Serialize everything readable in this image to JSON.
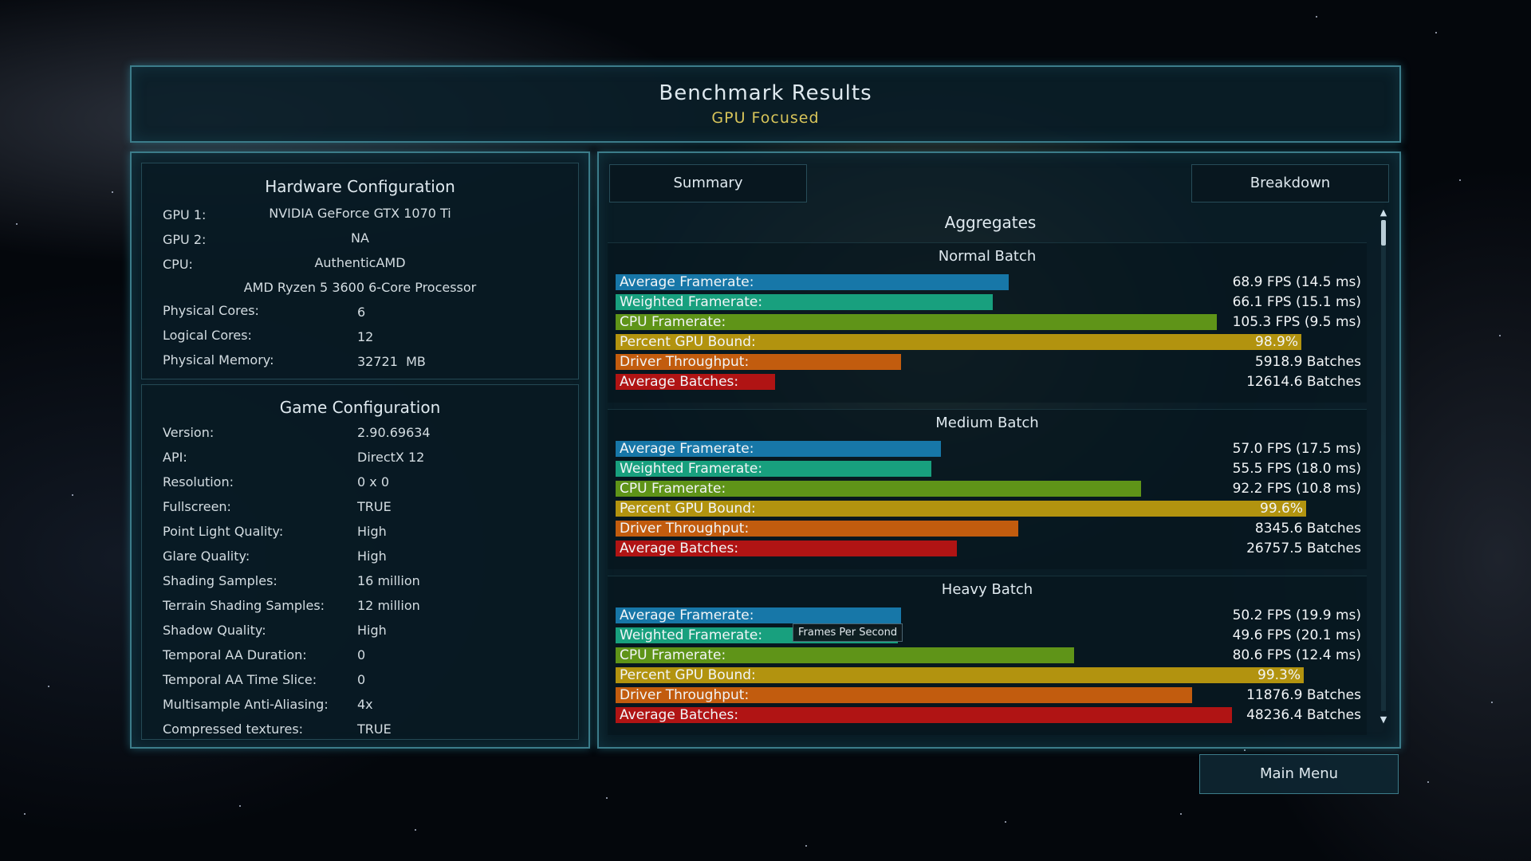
{
  "header": {
    "title": "Benchmark Results",
    "subtitle": "GPU Focused"
  },
  "hardware": {
    "title": "Hardware Configuration",
    "gpu1_label": "GPU 1:",
    "gpu1_value": "NVIDIA GeForce GTX 1070 Ti",
    "gpu2_label": "GPU 2:",
    "gpu2_value": "NA",
    "cpu_label": "CPU:",
    "cpu_value": "AuthenticAMD",
    "cpu_model": "AMD Ryzen 5 3600 6-Core Processor",
    "physical_cores_label": "Physical Cores:",
    "physical_cores_value": "6",
    "logical_cores_label": "Logical Cores:",
    "logical_cores_value": "12",
    "memory_label": "Physical Memory:",
    "memory_value": "32721  MB"
  },
  "game": {
    "title": "Game Configuration",
    "settings": [
      {
        "label": "Version:",
        "value": "2.90.69634"
      },
      {
        "label": "API:",
        "value": "DirectX 12"
      },
      {
        "label": "Resolution:",
        "value": "0 x 0"
      },
      {
        "label": "Fullscreen:",
        "value": "TRUE"
      },
      {
        "label": "Point Light Quality:",
        "value": "High"
      },
      {
        "label": "Glare Quality:",
        "value": "High"
      },
      {
        "label": "Shading Samples:",
        "value": "16 million"
      },
      {
        "label": "Terrain Shading Samples:",
        "value": "12 million"
      },
      {
        "label": "Shadow Quality:",
        "value": "High"
      },
      {
        "label": "Temporal AA Duration:",
        "value": "0"
      },
      {
        "label": "Temporal AA Time Slice:",
        "value": "0"
      },
      {
        "label": "Multisample Anti-Aliasing:",
        "value": "4x"
      },
      {
        "label": "Compressed textures:",
        "value": "TRUE"
      }
    ]
  },
  "tabs": {
    "summary": "Summary",
    "breakdown": "Breakdown"
  },
  "aggregates_title": "Aggregates",
  "colors": {
    "average_framerate": "#1777a8",
    "weighted_framerate": "#18a07e",
    "cpu_framerate": "#5f9418",
    "percent_gpu_bound": "#b2930f",
    "driver_throughput": "#c25c0e",
    "average_batches": "#b01414"
  },
  "batches": [
    {
      "title": "Normal Batch",
      "metrics": [
        {
          "key": "average_framerate",
          "label": "Average Framerate:",
          "value": "68.9 FPS (14.5 ms)",
          "fill": 0.527
        },
        {
          "key": "weighted_framerate",
          "label": "Weighted Framerate:",
          "value": "66.1 FPS (15.1 ms)",
          "fill": 0.506
        },
        {
          "key": "cpu_framerate",
          "label": "CPU Framerate:",
          "value": "105.3 FPS (9.5 ms)",
          "fill": 0.806
        },
        {
          "key": "percent_gpu_bound",
          "label": "Percent GPU Bound:",
          "value": "98.9%",
          "fill": 0.989,
          "inside": true
        },
        {
          "key": "driver_throughput",
          "label": "Driver Throughput:",
          "value": "5918.9 Batches",
          "fill": 0.383
        },
        {
          "key": "average_batches",
          "label": "Average Batches:",
          "value": "12614.6 Batches",
          "fill": 0.214
        }
      ]
    },
    {
      "title": "Medium Batch",
      "metrics": [
        {
          "key": "average_framerate",
          "label": "Average Framerate:",
          "value": "57.0 FPS (17.5 ms)",
          "fill": 0.436
        },
        {
          "key": "weighted_framerate",
          "label": "Weighted Framerate:",
          "value": "55.5 FPS (18.0 ms)",
          "fill": 0.424
        },
        {
          "key": "cpu_framerate",
          "label": "CPU Framerate:",
          "value": "92.2 FPS (10.8 ms)",
          "fill": 0.705
        },
        {
          "key": "percent_gpu_bound",
          "label": "Percent GPU Bound:",
          "value": "99.6%",
          "fill": 0.996,
          "inside": true
        },
        {
          "key": "driver_throughput",
          "label": "Driver Throughput:",
          "value": "8345.6 Batches",
          "fill": 0.54
        },
        {
          "key": "average_batches",
          "label": "Average Batches:",
          "value": "26757.5 Batches",
          "fill": 0.458
        }
      ]
    },
    {
      "title": "Heavy Batch",
      "metrics": [
        {
          "key": "average_framerate",
          "label": "Average Framerate:",
          "value": "50.2 FPS (19.9 ms)",
          "fill": 0.383
        },
        {
          "key": "weighted_framerate",
          "label": "Weighted Framerate:",
          "value": "49.6 FPS (20.1 ms)",
          "fill": 0.379
        },
        {
          "key": "cpu_framerate",
          "label": "CPU Framerate:",
          "value": "80.6 FPS (12.4 ms)",
          "fill": 0.615
        },
        {
          "key": "percent_gpu_bound",
          "label": "Percent GPU Bound:",
          "value": "99.3%",
          "fill": 0.993,
          "inside": true
        },
        {
          "key": "driver_throughput",
          "label": "Driver Throughput:",
          "value": "11876.9 Batches",
          "fill": 0.773
        },
        {
          "key": "average_batches",
          "label": "Average Batches:",
          "value": "48236.4 Batches",
          "fill": 0.827
        }
      ]
    }
  ],
  "tooltip": "Frames Per Second",
  "scrollbar": {
    "up_glyph": "▲",
    "down_glyph": "▼"
  },
  "main_menu": "Main Menu"
}
